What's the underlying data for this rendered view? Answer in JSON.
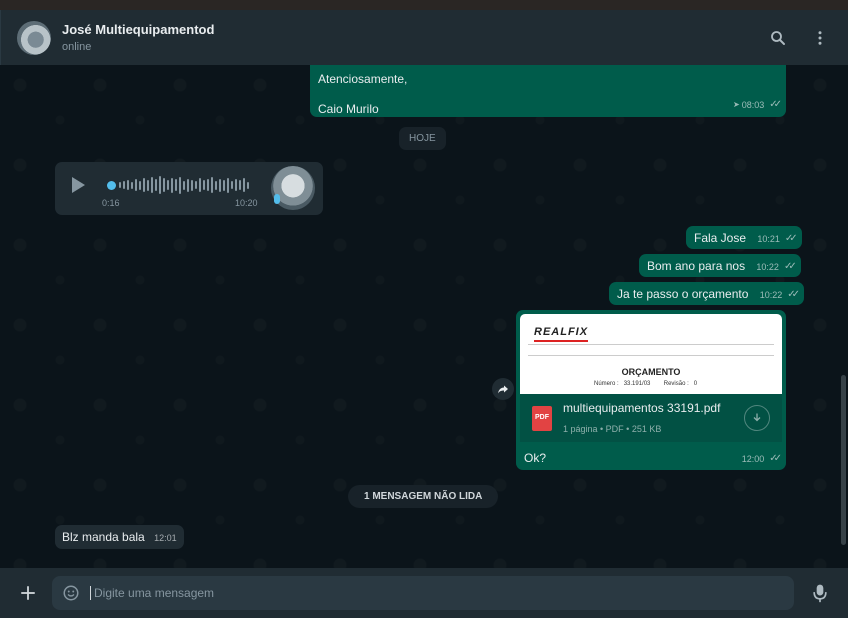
{
  "header": {
    "contact_name": "José Multiequipamentod",
    "status": "online"
  },
  "messages": {
    "signature": {
      "line1": "Atenciosamente,",
      "line2": "Caio Murilo",
      "time": "08:03"
    },
    "date_divider": "HOJE",
    "voice": {
      "elapsed": "0:16",
      "time": "10:20"
    },
    "m1": {
      "text": "Fala Jose",
      "time": "10:21"
    },
    "m2": {
      "text": "Bom ano para nos",
      "time": "10:22"
    },
    "m3": {
      "text": "Ja te passo o orçamento",
      "time": "10:22"
    },
    "pdf": {
      "preview_brand": "REALFIX",
      "preview_title": "ORÇAMENTO",
      "preview_numero_label": "Número :",
      "preview_numero_value": "33.191/03",
      "preview_revisao_label": "Revisão :",
      "preview_revisao_value": "0",
      "badge": "PDF",
      "filename": "multiequipamentos 33191.pdf",
      "info": "1 página • PDF • 251 KB",
      "caption": "Ok?",
      "time": "12:00"
    },
    "unread_divider": "1 MENSAGEM NÃO LIDA",
    "reply": {
      "text": "Blz manda bala",
      "time": "12:01"
    }
  },
  "composer": {
    "placeholder": "Digite uma mensagem"
  },
  "colors": {
    "outgoing_bubble": "#005c4b",
    "incoming_bubble": "#202c33",
    "accent": "#53bdeb"
  }
}
